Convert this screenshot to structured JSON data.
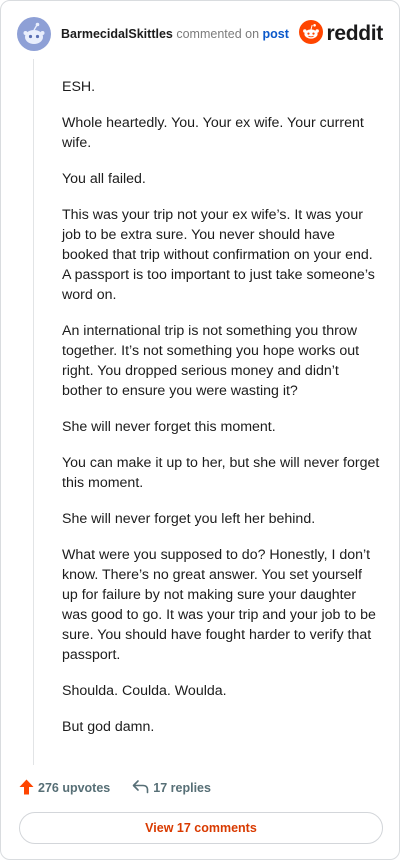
{
  "header": {
    "username": "BarmecidalSkittles",
    "action": "commented on",
    "target": "post",
    "brand": "reddit"
  },
  "comment": {
    "paragraphs": [
      "ESH.",
      "Whole heartedly. You. Your ex wife. Your current wife.",
      "You all failed.",
      "This was your trip not your ex wife’s. It was your job to be extra sure. You never should have booked that trip without confirmation on your end. A passport is too important to just take someone’s word on.",
      "An international trip is not something you throw together. It’s not something you hope works out right. You dropped serious money and didn’t bother to ensure you were wasting it?",
      "She will never forget this moment.",
      "You can make it up to her, but she will never forget this moment.",
      "She will never forget you left her behind.",
      "What were you supposed to do? Honestly, I don’t know. There’s no great answer. You set yourself up for failure by not making sure your daughter was good to go. It was your trip and your job to be sure. You should have fought harder to verify that passport.",
      "Shoulda. Coulda. Woulda.",
      "But god damn."
    ]
  },
  "footer": {
    "upvotes": "276 upvotes",
    "replies": "17 replies",
    "view_button": "View 17 comments"
  },
  "colors": {
    "brand_orange": "#ff4500",
    "link_blue": "#0a58ca",
    "button_text": "#d93a00"
  },
  "icons": {
    "avatar": "snoo-avatar-icon",
    "brand": "reddit-logo-icon",
    "upvote": "upvote-arrow-icon",
    "reply": "reply-arrow-icon"
  }
}
